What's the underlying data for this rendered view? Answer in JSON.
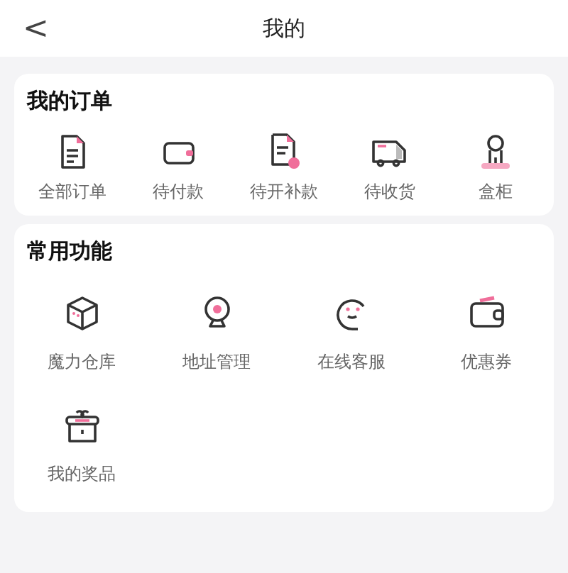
{
  "header": {
    "back": "<",
    "title": "我的"
  },
  "orders": {
    "title": "我的订单",
    "items": [
      {
        "label": "全部订单",
        "kind": "document"
      },
      {
        "label": "待付款",
        "kind": "wallet"
      },
      {
        "label": "待开补款",
        "kind": "invoice"
      },
      {
        "label": "待收货",
        "kind": "truck"
      },
      {
        "label": "盒柜",
        "kind": "figure"
      }
    ]
  },
  "features": {
    "title": "常用功能",
    "items": [
      {
        "label": "魔力仓库",
        "kind": "cube"
      },
      {
        "label": "地址管理",
        "kind": "pin"
      },
      {
        "label": "在线客服",
        "kind": "service"
      },
      {
        "label": "优惠券",
        "kind": "coupon"
      },
      {
        "label": "我的奖品",
        "kind": "gift"
      }
    ]
  }
}
